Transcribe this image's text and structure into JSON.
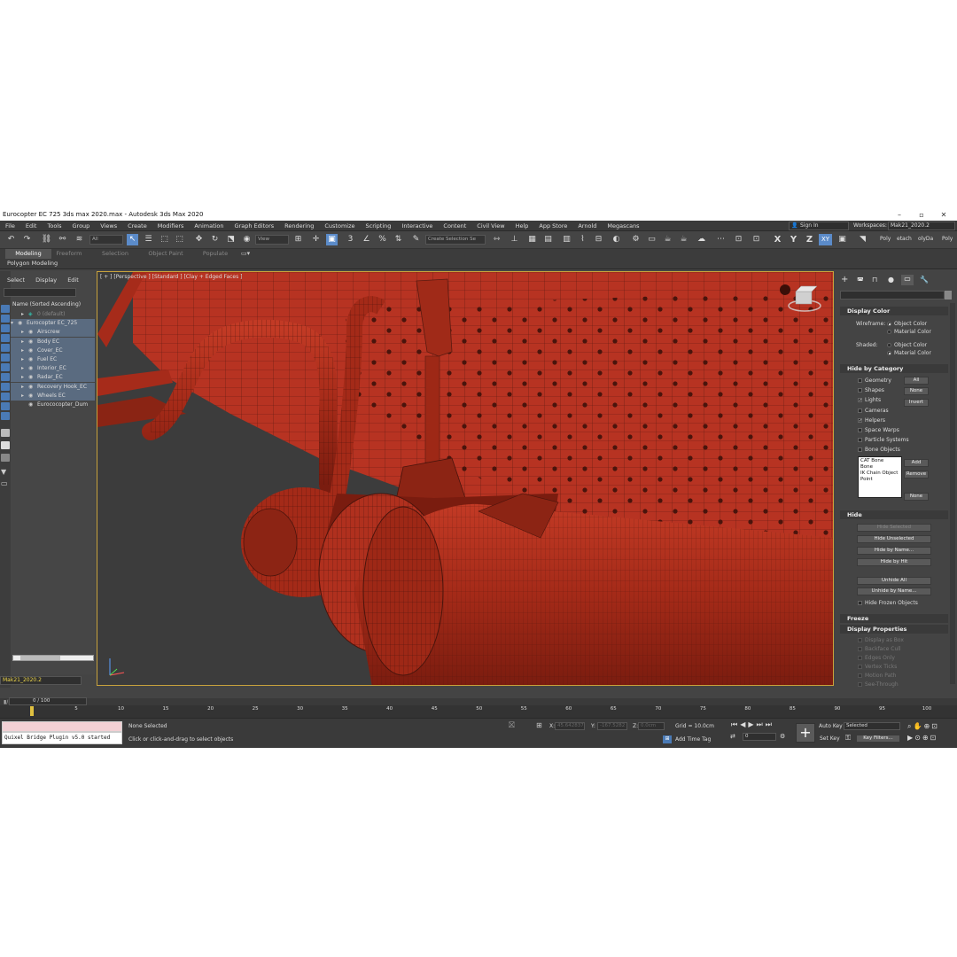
{
  "window": {
    "title": "Eurocopter EC 725 3ds max 2020.max - Autodesk 3ds Max 2020",
    "minimize": "–",
    "maximize": "▫",
    "close": "✕"
  },
  "menu": [
    "File",
    "Edit",
    "Tools",
    "Group",
    "Views",
    "Create",
    "Modifiers",
    "Animation",
    "Graph Editors",
    "Rendering",
    "Customize",
    "Scripting",
    "Interactive",
    "Content",
    "Civil View",
    "Help",
    "App Store",
    "Arnold",
    "Megascans"
  ],
  "account": {
    "sign_in": "Sign In",
    "workspaces_label": "Workspaces:",
    "workspace": "Mak21_2020.2"
  },
  "toolbar": {
    "filter_value": "All",
    "ref_coord": "View",
    "selection_set_placeholder": "Create Selection Se",
    "axis_x": "X",
    "axis_y": "Y",
    "axis_z": "Z",
    "axis_xy": "XY",
    "snap_3": "3",
    "percent": "%",
    "right_tabs": [
      "Poly",
      "etach",
      "olyDa",
      "Poly"
    ]
  },
  "ribbon": {
    "tabs": [
      "Modeling",
      "Freeform",
      "Selection",
      "Object Paint",
      "Populate"
    ],
    "active_tab": "Modeling",
    "sub_label": "Polygon Modeling"
  },
  "scene_explorer": {
    "menu": [
      "Select",
      "Display",
      "Edit"
    ],
    "header": "Name (Sorted Ascending)",
    "rows": [
      {
        "label": "0 (default)",
        "dim": true
      },
      {
        "label": "Eurocopter EC_725",
        "dim": false
      },
      {
        "label": "Airscrew",
        "dim": false
      },
      {
        "label": "Body EC",
        "dim": false
      },
      {
        "label": "Cover_EC",
        "dim": false
      },
      {
        "label": "Fuel EC",
        "dim": false
      },
      {
        "label": "Interior_EC",
        "dim": false
      },
      {
        "label": "Radar_EC",
        "dim": false
      },
      {
        "label": "Recovery Hook_EC",
        "dim": false
      },
      {
        "label": "Wheels EC",
        "dim": false
      },
      {
        "label": "Eurococopter_Dum",
        "dim": false
      }
    ],
    "layer_field": "Mak21_2020.2"
  },
  "viewport": {
    "label": "[ + ] [Perspective ] [Standard ] [Clay + Edged Faces ]"
  },
  "command_panel": {
    "display_color": {
      "title": "Display Color",
      "wireframe_label": "Wireframe:",
      "shaded_label": "Shaded:",
      "object_color": "Object Color",
      "material_color": "Material Color"
    },
    "hide_by_category": {
      "title": "Hide by Category",
      "items": [
        {
          "label": "Geometry",
          "checked": false
        },
        {
          "label": "Shapes",
          "checked": false
        },
        {
          "label": "Lights",
          "checked": true
        },
        {
          "label": "Cameras",
          "checked": false
        },
        {
          "label": "Helpers",
          "checked": true
        },
        {
          "label": "Space Warps",
          "checked": false
        },
        {
          "label": "Particle Systems",
          "checked": false
        },
        {
          "label": "Bone Objects",
          "checked": false
        }
      ],
      "buttons": [
        "All",
        "None",
        "Invert"
      ],
      "list": [
        "CAT Bone",
        "Bone",
        "IK Chain Object",
        "Point"
      ],
      "add": "Add",
      "remove": "Remove",
      "none": "None"
    },
    "hide": {
      "title": "Hide",
      "buttons": [
        "Hide Selected",
        "Hide Unselected",
        "Hide by Name...",
        "Hide by Hit",
        "Unhide All",
        "Unhide by Name..."
      ],
      "hide_frozen": "Hide Frozen Objects"
    },
    "freeze": {
      "title": "Freeze"
    },
    "display_properties": {
      "title": "Display Properties",
      "items": [
        "Display as Box",
        "Backface Cull",
        "Edges Only",
        "Vertex Ticks",
        "Motion Path",
        "See-Through"
      ]
    }
  },
  "timeline": {
    "frame_counter": "0 / 100",
    "ticks": [
      "5",
      "10",
      "15",
      "20",
      "25",
      "30",
      "35",
      "40",
      "45",
      "50",
      "55",
      "60",
      "65",
      "70",
      "75",
      "80",
      "85",
      "90",
      "95",
      "100"
    ]
  },
  "status": {
    "maxscript_output": "Quixel Bridge Plugin v5.0 started",
    "selection": "None Selected",
    "prompt": "Click or click-and-drag to select objects",
    "x_label": "X:",
    "x_value": "45.642837",
    "y_label": "Y:",
    "y_value": "-167.5282",
    "z_label": "Z:",
    "z_value": "0.0cm",
    "grid": "Grid = 10.0cm",
    "add_time_tag": "Add Time Tag",
    "auto_key": "Auto Key",
    "set_key": "Set Key",
    "selected": "Selected",
    "key_filters": "Key Filters...",
    "frame_field": "0"
  },
  "colors": {
    "accent": "#5b8bc9",
    "model_red": "#b83020",
    "viewport_border": "#c8a23c"
  }
}
